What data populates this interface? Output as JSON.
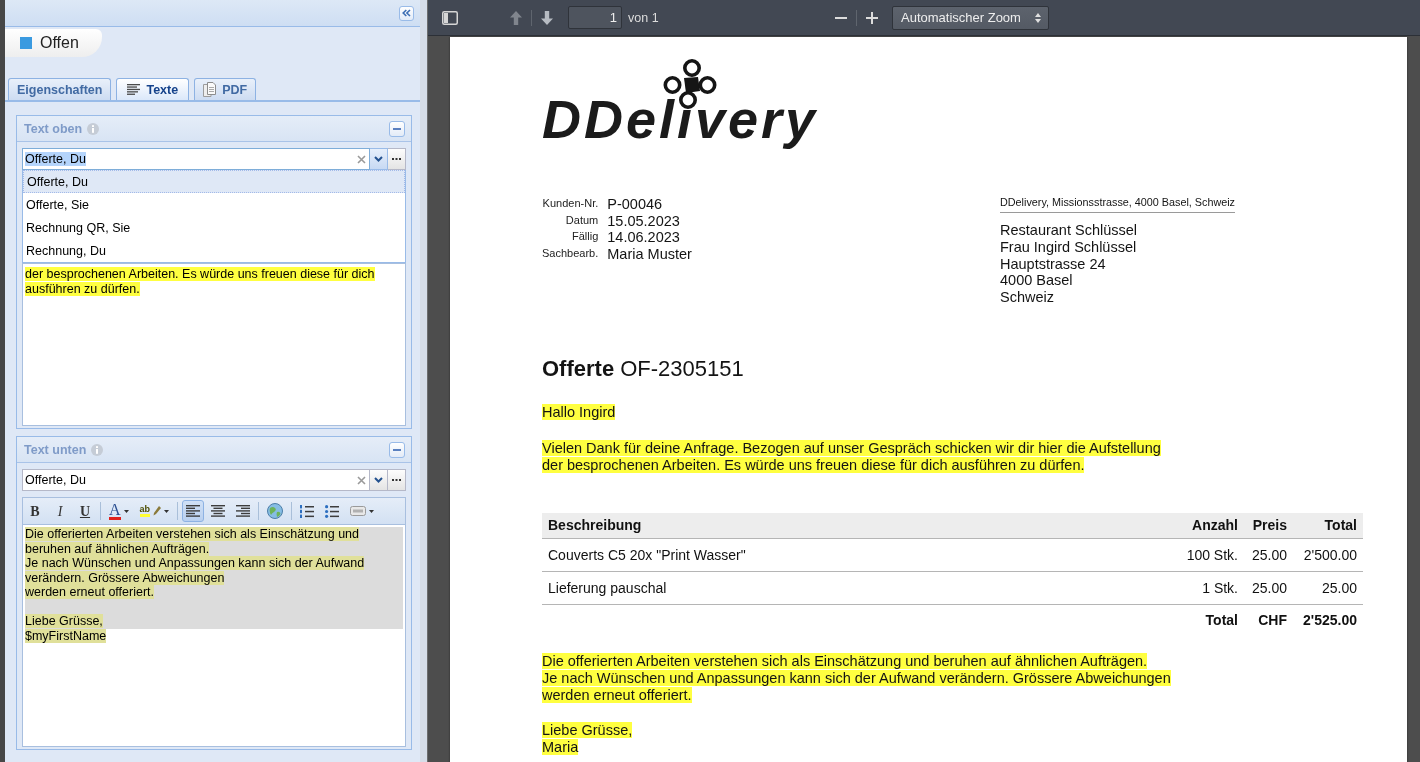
{
  "side_panel": {
    "status": {
      "label": "Offen"
    },
    "tabs": [
      {
        "label": "Eigenschaften",
        "kind": "plain",
        "selected": false
      },
      {
        "label": "Texte",
        "kind": "lines",
        "selected": true
      },
      {
        "label": "PDF",
        "kind": "document",
        "selected": false
      }
    ],
    "sections": [
      {
        "title": "Text oben",
        "template_field": {
          "value": "Offerte, Du",
          "focused": true,
          "expanded": true,
          "options": [
            {
              "label": "Offerte, Du",
              "selected": true
            },
            {
              "label": "Offerte, Sie",
              "selected": false
            },
            {
              "label": "Rechnung QR, Sie",
              "selected": false
            },
            {
              "label": "Rechnung, Du",
              "selected": false
            }
          ]
        },
        "editor": {
          "active": true,
          "paragraphs": [
            {
              "lines": [
                {
                  "text": "der besprochenen Arbeiten. Es würde uns freuen diese für dich ausführen zu dürfen.",
                  "highlighted": true,
                  "selected": false
                }
              ]
            }
          ]
        }
      },
      {
        "title": "Text unten",
        "template_field": {
          "value": "Offerte, Du",
          "focused": false,
          "expanded": false
        },
        "toolbar": [
          [
            {
              "kind": "bold",
              "label": "B",
              "pressed": false
            },
            {
              "kind": "italic",
              "label": "I",
              "pressed": false
            },
            {
              "kind": "underline",
              "label": "U",
              "pressed": false
            }
          ],
          [
            {
              "kind": "font-color",
              "label": "A",
              "pressed": false
            },
            {
              "kind": "highlight",
              "label": "ab",
              "pressed": false
            }
          ],
          [
            {
              "kind": "align-left",
              "pressed": true
            },
            {
              "kind": "align-center",
              "pressed": false
            },
            {
              "kind": "align-right",
              "pressed": false
            }
          ],
          [
            {
              "kind": "link",
              "pressed": false
            }
          ],
          [
            {
              "kind": "ordered-list",
              "pressed": false
            },
            {
              "kind": "bullet-list",
              "pressed": false
            },
            {
              "kind": "box",
              "pressed": false
            }
          ]
        ],
        "editor": {
          "active": false,
          "paragraphs": [
            {
              "lines": [
                {
                  "text": "Die offerierten Arbeiten verstehen sich als Einschätzung und beruhen auf ähnlichen Aufträgen.",
                  "highlighted": true,
                  "selected": true
                },
                {
                  "text": "Je nach Wünschen und Anpassungen kann sich der Aufwand verändern. Grössere Abweichungen",
                  "highlighted": true,
                  "selected": true
                },
                {
                  "text": "werden erneut offeriert.",
                  "highlighted": true,
                  "selected": true
                }
              ]
            },
            {
              "lines": [
                {
                  "text": "Liebe Grüsse,",
                  "highlighted": true,
                  "selected": true
                },
                {
                  "text": "$myFirstName",
                  "highlighted": true,
                  "selected": false
                }
              ]
            }
          ]
        }
      }
    ]
  },
  "pdf_viewer": {
    "toolbar": {
      "nav": [
        {
          "kind": "previous",
          "disabled": true
        },
        {
          "kind": "next",
          "disabled": false
        }
      ],
      "page_number": "1",
      "page_total": "von 1",
      "zoom": "Automatischer Zoom"
    },
    "document": {
      "logo": "DDelivery",
      "meta": [
        {
          "label": "Kunden-Nr.",
          "value": "P-00046"
        },
        {
          "label": "Datum",
          "value": "15.05.2023"
        },
        {
          "label": "Fällig",
          "value": "14.06.2023"
        },
        {
          "label": "Sachbearb.",
          "value": "Maria Muster"
        }
      ],
      "sender_line": "DDelivery, Missionsstrasse, 4000 Basel, Schweiz",
      "recipient_address": [
        "Restaurant Schlüssel",
        "Frau Ingird Schlüssel",
        "Hauptstrasse 24",
        "4000 Basel",
        "Schweiz"
      ],
      "title": "**Offerte** OF-2305151",
      "intro": [
        {
          "lines": [
            "Hallo Ingird"
          ],
          "highlighted": true
        },
        {
          "lines": [
            "Vielen Dank für deine Anfrage. Bezogen auf unser Gespräch schicken wir dir hier die Aufstellung",
            "der besprochenen Arbeiten. Es würde uns freuen diese für dich ausführen zu dürfen."
          ],
          "highlighted": true
        }
      ],
      "table": {
        "columns": [
          "Beschreibung",
          "Anzahl",
          "Preis",
          "Total"
        ],
        "rows": [
          [
            "Couverts C5 20x \"Print Wasser\"",
            "100 Stk.",
            "25.00",
            "2'500.00"
          ],
          [
            "Lieferung pauschal",
            "1 Stk.",
            "25.00",
            "25.00"
          ]
        ],
        "total_row": [
          "Total",
          "CHF",
          "2'525.00"
        ]
      },
      "outro": [
        {
          "lines": [
            "Die offerierten Arbeiten verstehen sich als Einschätzung und beruhen auf ähnlichen Aufträgen.",
            "Je nach Wünschen und Anpassungen kann sich der Aufwand verändern. Grössere Abweichungen",
            "werden erneut offeriert."
          ],
          "highlighted": true
        },
        {
          "lines": [
            "Liebe Grüsse,",
            "Maria"
          ],
          "highlighted": true
        }
      ]
    }
  }
}
